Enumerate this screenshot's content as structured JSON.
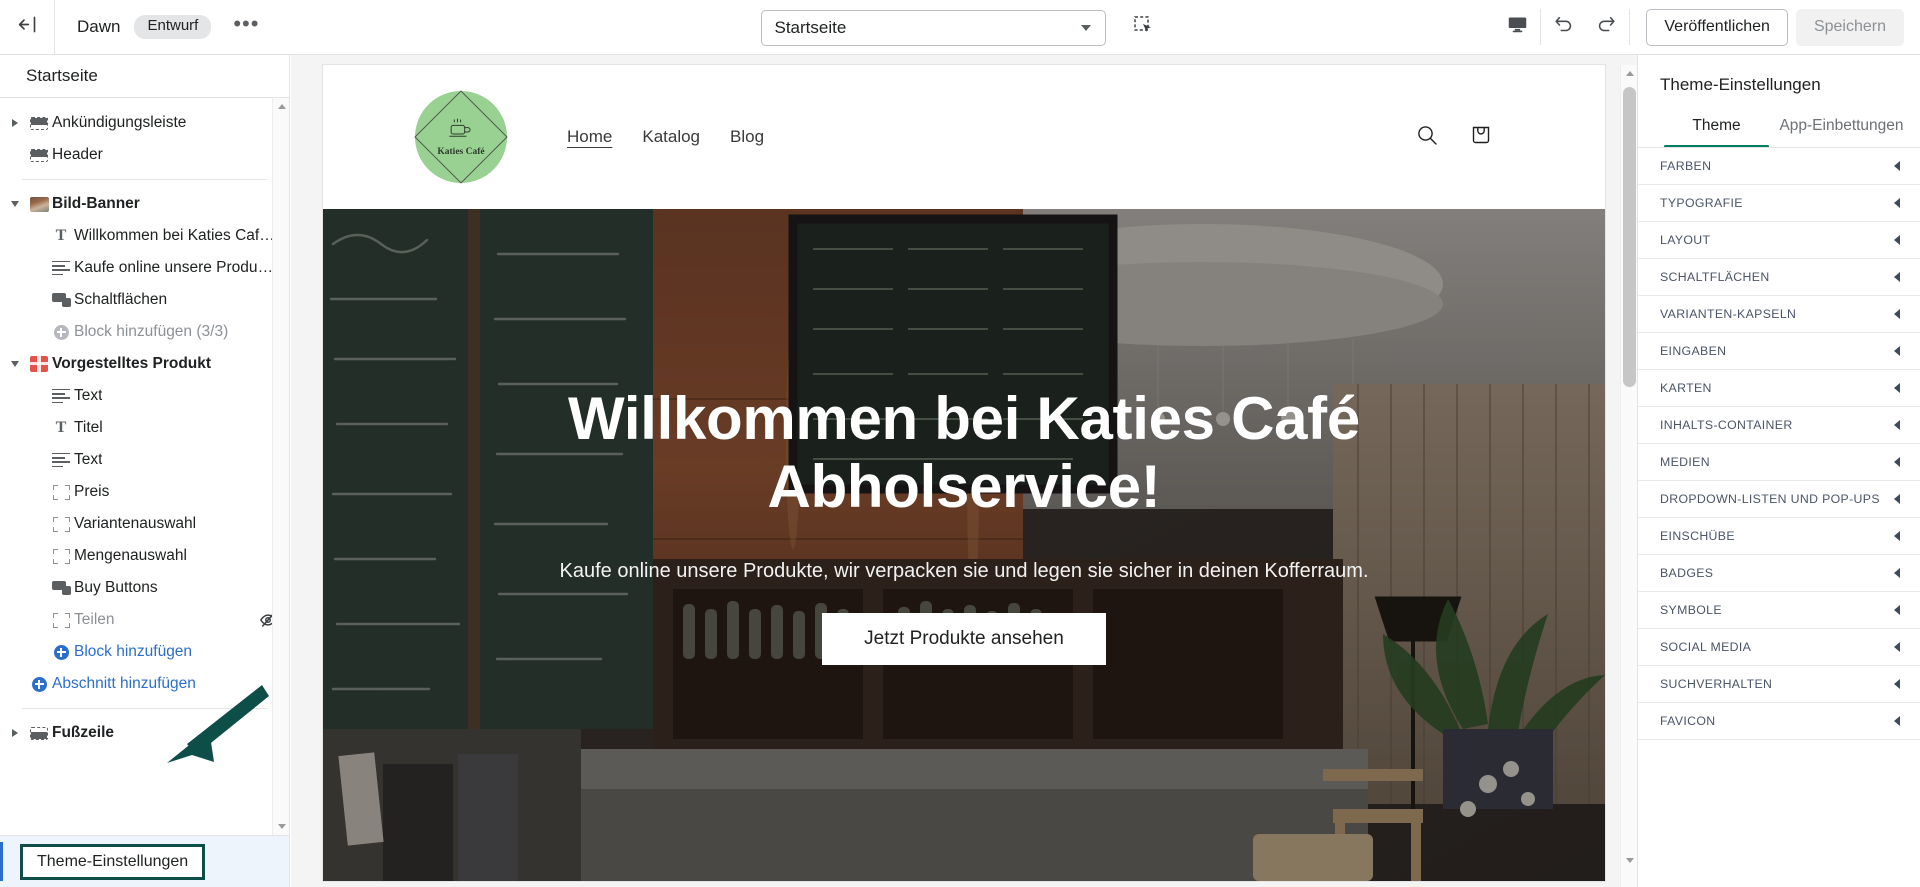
{
  "topbar": {
    "back_icon": "exit-left-icon",
    "theme_name": "Dawn",
    "status_badge": "Entwurf",
    "more_label": "•••",
    "page_selector_value": "Startseite",
    "select_tool_icon": "selection-cursor-icon",
    "device_icon": "desktop-icon",
    "undo_icon": "undo-icon",
    "redo_icon": "redo-icon",
    "publish_label": "Veröffentlichen",
    "save_label": "Speichern"
  },
  "sidebar": {
    "header": "Startseite",
    "tree": [
      {
        "label": "Ankündigungsleiste",
        "level": 1,
        "icon": "section-bar-icon",
        "twisty": "closed",
        "style": "normal"
      },
      {
        "label": "Header",
        "level": 1,
        "icon": "section-header-icon",
        "twisty": "none",
        "style": "normal"
      },
      {
        "sep": true
      },
      {
        "label": "Bild-Banner",
        "level": 1,
        "icon": "image-thumb-icon",
        "twisty": "open",
        "style": "bold"
      },
      {
        "label": "Willkommen bei Katies Café ...",
        "level": 2,
        "icon": "heading-T-icon",
        "style": "normal"
      },
      {
        "label": "Kaufe online unsere Produkte...",
        "level": 2,
        "icon": "text-lines-icon",
        "style": "normal"
      },
      {
        "label": "Schaltflächen",
        "level": 2,
        "icon": "buttons-icon",
        "style": "normal"
      },
      {
        "label": "Block hinzufügen (3/3)",
        "level": 2,
        "icon": "plus-circle-grey-icon",
        "style": "muted"
      },
      {
        "label": "Vorgestelltes Produkt",
        "level": 1,
        "icon": "gift-icon",
        "twisty": "open",
        "style": "bold"
      },
      {
        "label": "Text",
        "level": 2,
        "icon": "text-lines-icon",
        "style": "normal"
      },
      {
        "label": "Titel",
        "level": 2,
        "icon": "heading-T-icon",
        "style": "normal"
      },
      {
        "label": "Text",
        "level": 2,
        "icon": "text-lines-icon",
        "style": "normal"
      },
      {
        "label": "Preis",
        "level": 2,
        "icon": "block-brackets-icon",
        "style": "normal"
      },
      {
        "label": "Variantenauswahl",
        "level": 2,
        "icon": "block-brackets-icon",
        "style": "normal"
      },
      {
        "label": "Mengenauswahl",
        "level": 2,
        "icon": "block-brackets-icon",
        "style": "normal"
      },
      {
        "label": "Buy Buttons",
        "level": 2,
        "icon": "buttons-icon",
        "style": "normal"
      },
      {
        "label": "Teilen",
        "level": 2,
        "icon": "block-brackets-icon",
        "style": "muted",
        "hidden_icon": "eye-off-icon"
      },
      {
        "label": "Block hinzufügen",
        "level": 2,
        "icon": "plus-circle-icon",
        "style": "link"
      },
      {
        "label": "Abschnitt hinzufügen",
        "level": 1,
        "icon": "plus-circle-icon",
        "style": "link"
      },
      {
        "sep": true
      },
      {
        "label": "Fußzeile",
        "level": 1,
        "icon": "section-footer-icon",
        "twisty": "closed",
        "style": "bold"
      }
    ],
    "footer_button": "Theme-Einstellungen"
  },
  "preview": {
    "nav": [
      {
        "label": "Home",
        "active": true
      },
      {
        "label": "Katalog",
        "active": false
      },
      {
        "label": "Blog",
        "active": false
      }
    ],
    "logo_text": "Katies Café",
    "logo_icon": "coffee-cup-icon",
    "search_icon": "search-icon",
    "cart_icon": "shopping-bag-icon",
    "hero": {
      "heading": "Willkommen bei Katies Café Abholservice!",
      "subheading": "Kaufe online unsere Produkte, wir verpacken sie und legen sie sicher in deinen Kofferraum.",
      "button_label": "Jetzt Produkte ansehen"
    }
  },
  "right_panel": {
    "title": "Theme-Einstellungen",
    "tabs": [
      {
        "label": "Theme",
        "active": true
      },
      {
        "label": "App-Einbettungen",
        "active": false
      }
    ],
    "accent_color": "#008060",
    "items": [
      "FARBEN",
      "TYPOGRAFIE",
      "LAYOUT",
      "SCHALTFLÄCHEN",
      "VARIANTEN-KAPSELN",
      "EINGABEN",
      "KARTEN",
      "INHALTS-CONTAINER",
      "MEDIEN",
      "DROPDOWN-LISTEN UND POP-UPS",
      "EINSCHÜBE",
      "BADGES",
      "SYMBOLE",
      "SOCIAL MEDIA",
      "SUCHVERHALTEN",
      "FAVICON"
    ]
  },
  "annotation": {
    "arrow_icon": "pointer-arrow-annotation",
    "color": "#0d4f48"
  }
}
